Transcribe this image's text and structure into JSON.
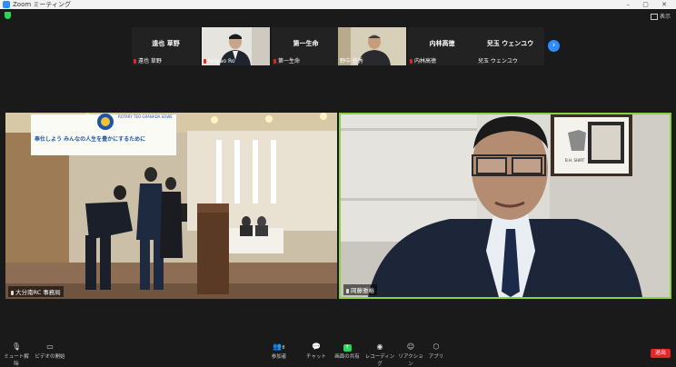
{
  "window": {
    "title": "Zoom ミーティング",
    "controls": "–  ▢  ✕"
  },
  "view_button": {
    "label": "表示"
  },
  "thumbnails": [
    {
      "name": "遠也 草野",
      "caption": "遠也 草野",
      "video": false
    },
    {
      "name": "",
      "caption": "hoiyao Ro",
      "video": true
    },
    {
      "name": "第一生命",
      "caption": "第一生命",
      "video": false
    },
    {
      "name": "",
      "caption": "野中 信秀",
      "video": true
    },
    {
      "name": "内林高徳",
      "caption": "内林高徳",
      "video": false
    },
    {
      "name": "兒玉 ウェンユウ",
      "caption": "兒玉 ウェンユウ",
      "video": false
    }
  ],
  "main_tiles": {
    "left": {
      "label": "大分南RC  事務局",
      "banner": "奉仕しよう みんなの人生を豊かにするために",
      "logo_text": "ROTARY TEO GRANADA SOWE"
    },
    "right": {
      "label": "岡藤雅裕",
      "frame_text": "B.H. SHIRT"
    }
  },
  "toolbar": {
    "mute": "ミュート解除",
    "video": "ビデオの開始",
    "participants": "参加者",
    "participants_count": "8",
    "chat": "チャット",
    "share": "画面の共有",
    "record": "レコーディング",
    "reactions": "リアクション",
    "apps": "アプリ",
    "end": "退出"
  },
  "colors": {
    "accent": "#2d8cff",
    "active_speaker": "#8bd23c",
    "end": "#e02828",
    "share": "#23d959"
  }
}
